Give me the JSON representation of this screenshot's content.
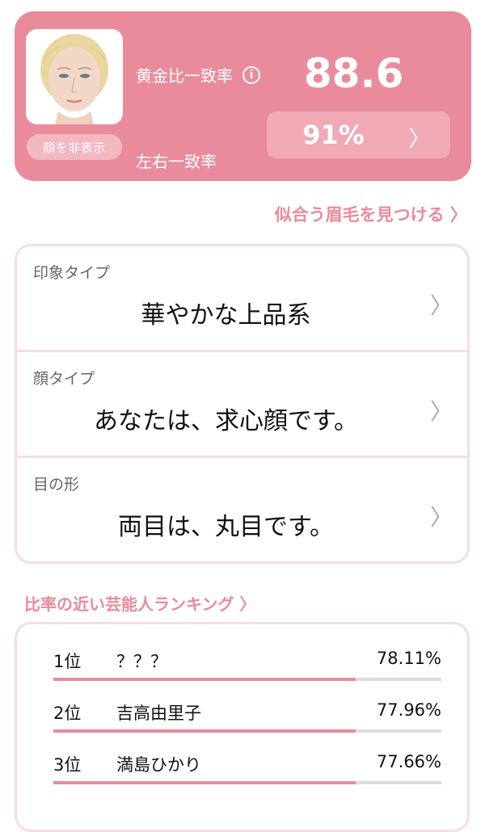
{
  "hero": {
    "photo_alt": "face photo",
    "hide_face_label": "顔を非表示",
    "golden_ratio_label": "黄金比一致率",
    "golden_ratio_value": "88.6",
    "symmetry_label": "左右一致率",
    "symmetry_value": "91%",
    "info_icon": "info-icon",
    "chevron_icon": "chevron-right-icon"
  },
  "find_eyebrows_link": "似合う眉毛を見つける 〉",
  "analysis": [
    {
      "label": "印象タイプ",
      "value": "華やかな上品系"
    },
    {
      "label": "顔タイプ",
      "value": "あなたは、求心顔です。"
    },
    {
      "label": "目の形",
      "value": "両目は、丸目です。"
    }
  ],
  "ranking_link": "比率の近い芸能人ランキング 〉",
  "ranking": [
    {
      "rank": "1位",
      "name": "？？？",
      "percent": "78.11%",
      "fill": 0.78
    },
    {
      "rank": "2位",
      "name": "吉高由里子",
      "percent": "77.96%",
      "fill": 0.78
    },
    {
      "rank": "3位",
      "name": "満島ひかり",
      "percent": "77.66%",
      "fill": 0.78
    }
  ],
  "colors": {
    "accent": "#e98b9b",
    "border": "#f6dde3"
  }
}
